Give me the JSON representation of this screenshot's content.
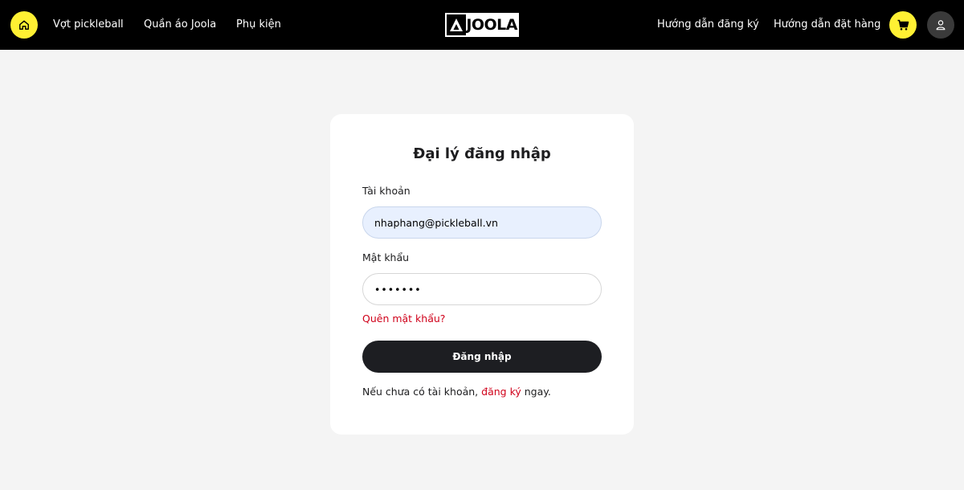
{
  "header": {
    "home_icon": "home-icon",
    "nav_left": [
      {
        "label": "Vợt pickleball"
      },
      {
        "label": "Quần áo Joola"
      },
      {
        "label": "Phụ kiện"
      }
    ],
    "logo_text": "JOOLA",
    "nav_right": [
      {
        "label": "Hướng dẫn đăng ký"
      },
      {
        "label": "Hướng dẫn đặt hàng"
      }
    ],
    "cart_icon": "cart-icon",
    "user_icon": "user-icon"
  },
  "login": {
    "title": "Đại lý đăng nhập",
    "account_label": "Tài khoản",
    "account_value": "nhaphang@pickleball.vn",
    "password_label": "Mật khẩu",
    "password_value": "•••••••",
    "forgot_label": "Quên mật khẩu?",
    "submit_label": "Đăng nhập",
    "signup_prefix": "Nếu chưa có tài khoản,",
    "signup_link": "đăng ký",
    "signup_suffix": "ngay."
  },
  "colors": {
    "header_bg": "#000000",
    "accent_yellow": "#fff033",
    "link_red": "#d0021b",
    "button_dark": "#1d1e22",
    "autofill_blue": "#e8f0fe"
  }
}
